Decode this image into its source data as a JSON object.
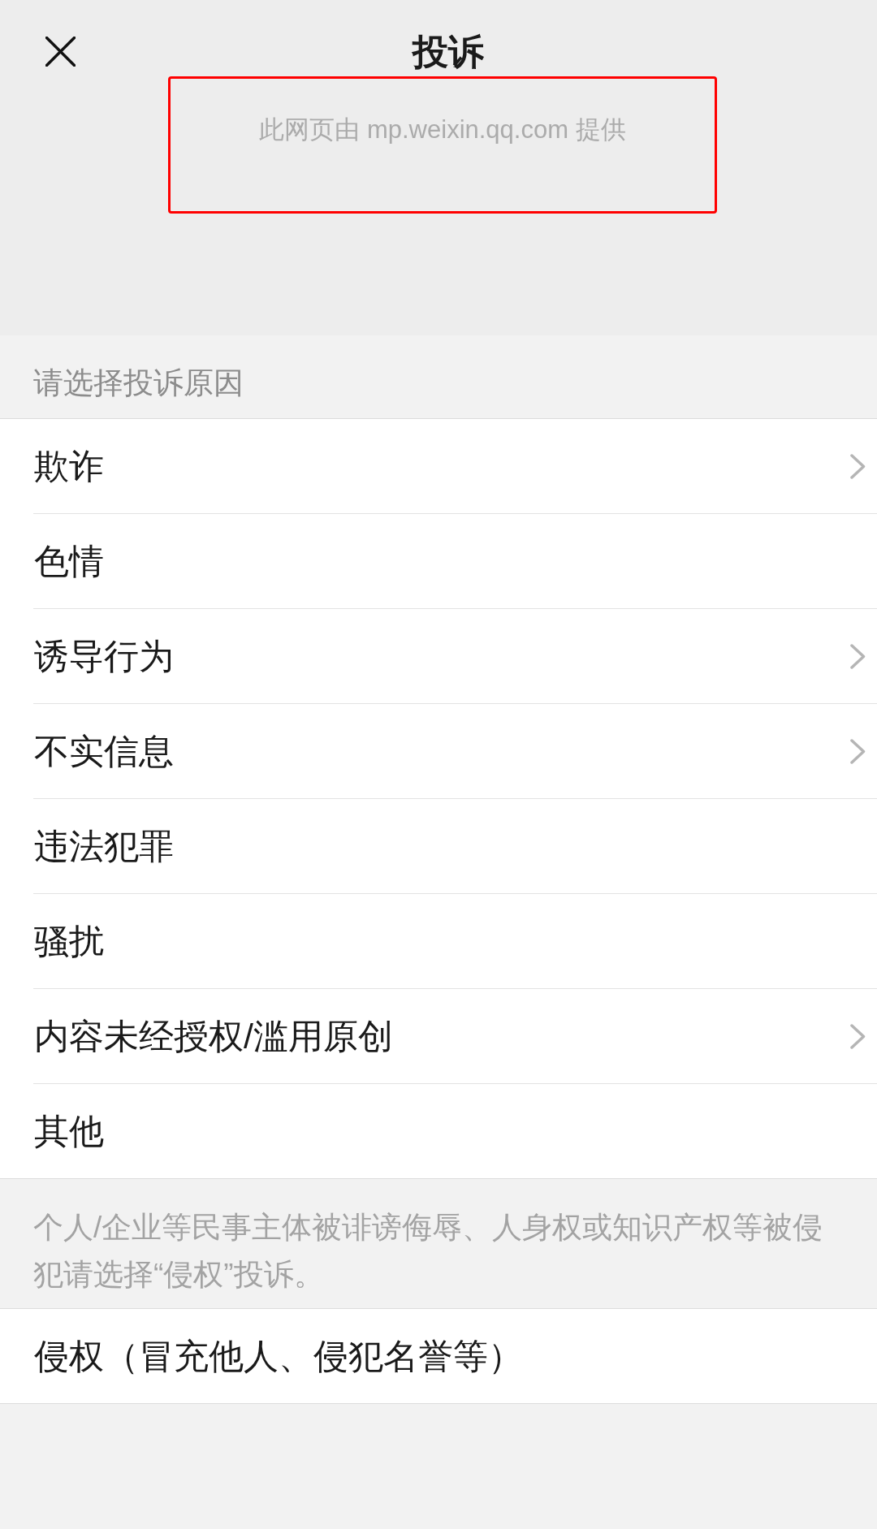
{
  "header": {
    "title": "投诉",
    "provider_notice": {
      "text": "此网页由 mp.weixin.qq.com 提供",
      "highlighted": true
    }
  },
  "section_title": "请选择投诉原因",
  "reasons": [
    {
      "label": "欺诈",
      "has_submenu": true
    },
    {
      "label": "色情",
      "has_submenu": false
    },
    {
      "label": "诱导行为",
      "has_submenu": true
    },
    {
      "label": "不实信息",
      "has_submenu": true
    },
    {
      "label": "违法犯罪",
      "has_submenu": false
    },
    {
      "label": "骚扰",
      "has_submenu": false
    },
    {
      "label": "内容未经授权/滥用原创",
      "has_submenu": true
    },
    {
      "label": "其他",
      "has_submenu": false
    }
  ],
  "note": "个人/企业等民事主体被诽谤侮辱、人身权或知识产权等被侵犯请选择“侵权”投诉。",
  "extra_reasons": [
    {
      "label": "侵权（冒充他人、侵犯名誉等）",
      "has_submenu": false
    }
  ]
}
